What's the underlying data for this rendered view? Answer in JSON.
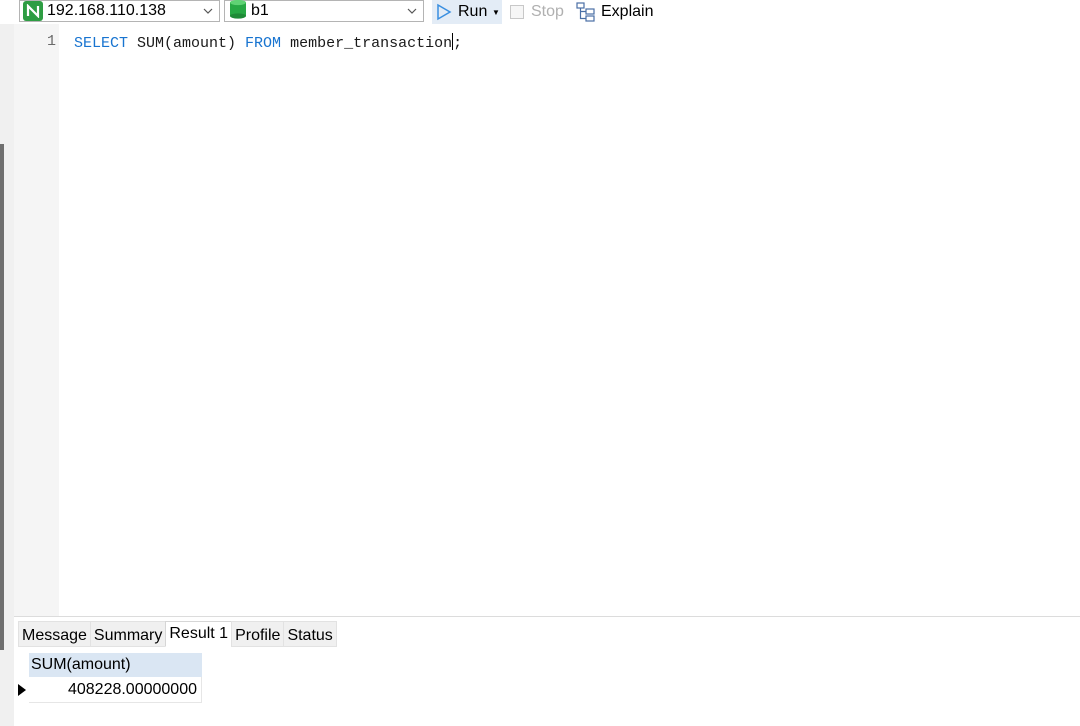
{
  "toolbar": {
    "connection": "192.168.110.138",
    "database": "b1",
    "run_label": "Run",
    "stop_label": "Stop",
    "explain_label": "Explain"
  },
  "editor": {
    "line_number": "1",
    "keyword_select": "SELECT",
    "expression": " SUM(amount) ",
    "keyword_from": "FROM",
    "table_text": " member_transaction",
    "terminator": ";"
  },
  "result_panel": {
    "tabs": [
      "Message",
      "Summary",
      "Result 1",
      "Profile",
      "Status"
    ],
    "active_tab": "Result 1",
    "columns": [
      "SUM(amount)"
    ],
    "rows": [
      [
        "408228.00000000"
      ]
    ]
  },
  "icons": {
    "connection": "server-connection-icon",
    "database": "database-icon",
    "run": "play-icon",
    "stop": "stop-icon",
    "explain": "explain-icon"
  }
}
